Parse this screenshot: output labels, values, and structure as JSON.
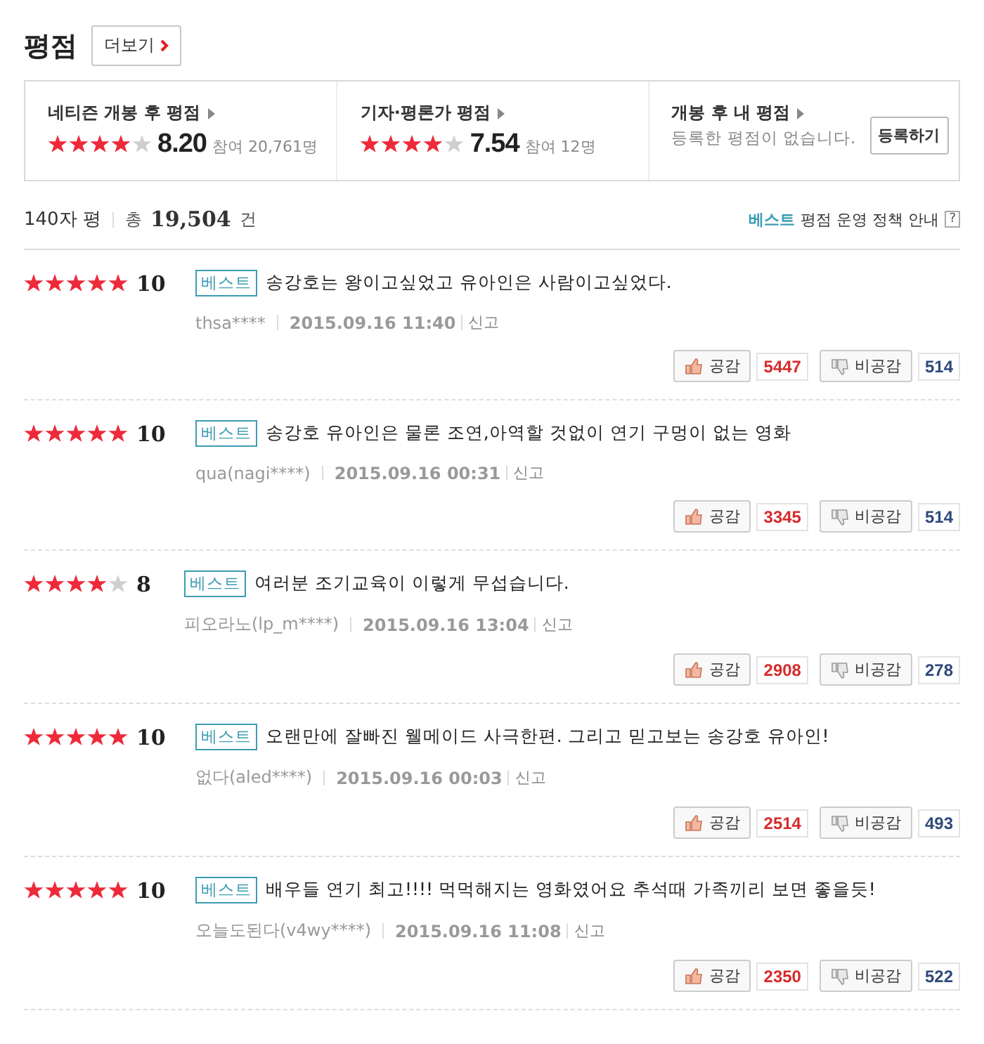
{
  "header": {
    "title": "평점",
    "more_button": "더보기"
  },
  "summary": [
    {
      "label": "네티즌 개봉 후 평점",
      "stars": 4,
      "score": "8.20",
      "participants": "참여 20,761명"
    },
    {
      "label": "기자·평론가 평점",
      "stars": 4,
      "score": "7.54",
      "participants": "참여 12명"
    },
    {
      "label": "개봉 후 내 평점",
      "message": "등록한 평점이 없습니다.",
      "button": "등록하기"
    }
  ],
  "list_header": {
    "type": "140자 평",
    "total_prefix": "총",
    "total": "19,504",
    "total_suffix": "건",
    "policy_highlight": "베스트",
    "policy": "평점 운영 정책 안내",
    "help": "?"
  },
  "reviews": [
    {
      "stars": 5,
      "score": "10",
      "badge": "베스트",
      "text": "송강호는 왕이고싶었고 유아인은 사람이고싶었다.",
      "author": "thsa****",
      "date": "2015.09.16 11:40",
      "report": "신고",
      "like_label": "공감",
      "likes": "5447",
      "dislike_label": "비공감",
      "dislikes": "514"
    },
    {
      "stars": 5,
      "score": "10",
      "badge": "베스트",
      "text": "송강호 유아인은 물론 조연,아역할 것없이 연기 구멍이 없는 영화",
      "author": "qua(nagi****)",
      "date": "2015.09.16 00:31",
      "report": "신고",
      "like_label": "공감",
      "likes": "3345",
      "dislike_label": "비공감",
      "dislikes": "514"
    },
    {
      "stars": 4,
      "score": "8",
      "badge": "베스트",
      "text": "여러분 조기교육이 이렇게 무섭습니다.",
      "author": "피오라노(lp_m****)",
      "date": "2015.09.16 13:04",
      "report": "신고",
      "like_label": "공감",
      "likes": "2908",
      "dislike_label": "비공감",
      "dislikes": "278"
    },
    {
      "stars": 5,
      "score": "10",
      "badge": "베스트",
      "text": "오랜만에 잘빠진 웰메이드 사극한편. 그리고 믿고보는 송강호 유아인!",
      "author": "없다(aled****)",
      "date": "2015.09.16 00:03",
      "report": "신고",
      "like_label": "공감",
      "likes": "2514",
      "dislike_label": "비공감",
      "dislikes": "493"
    },
    {
      "stars": 5,
      "score": "10",
      "badge": "베스트",
      "text": "배우들 연기 최고!!!! 먹먹해지는 영화였어요 추석때 가족끼리 보면 좋을듯!",
      "author": "오늘도된다(v4wy****)",
      "date": "2015.09.16 11:08",
      "report": "신고",
      "like_label": "공감",
      "likes": "2350",
      "dislike_label": "비공감",
      "dislikes": "522"
    }
  ]
}
